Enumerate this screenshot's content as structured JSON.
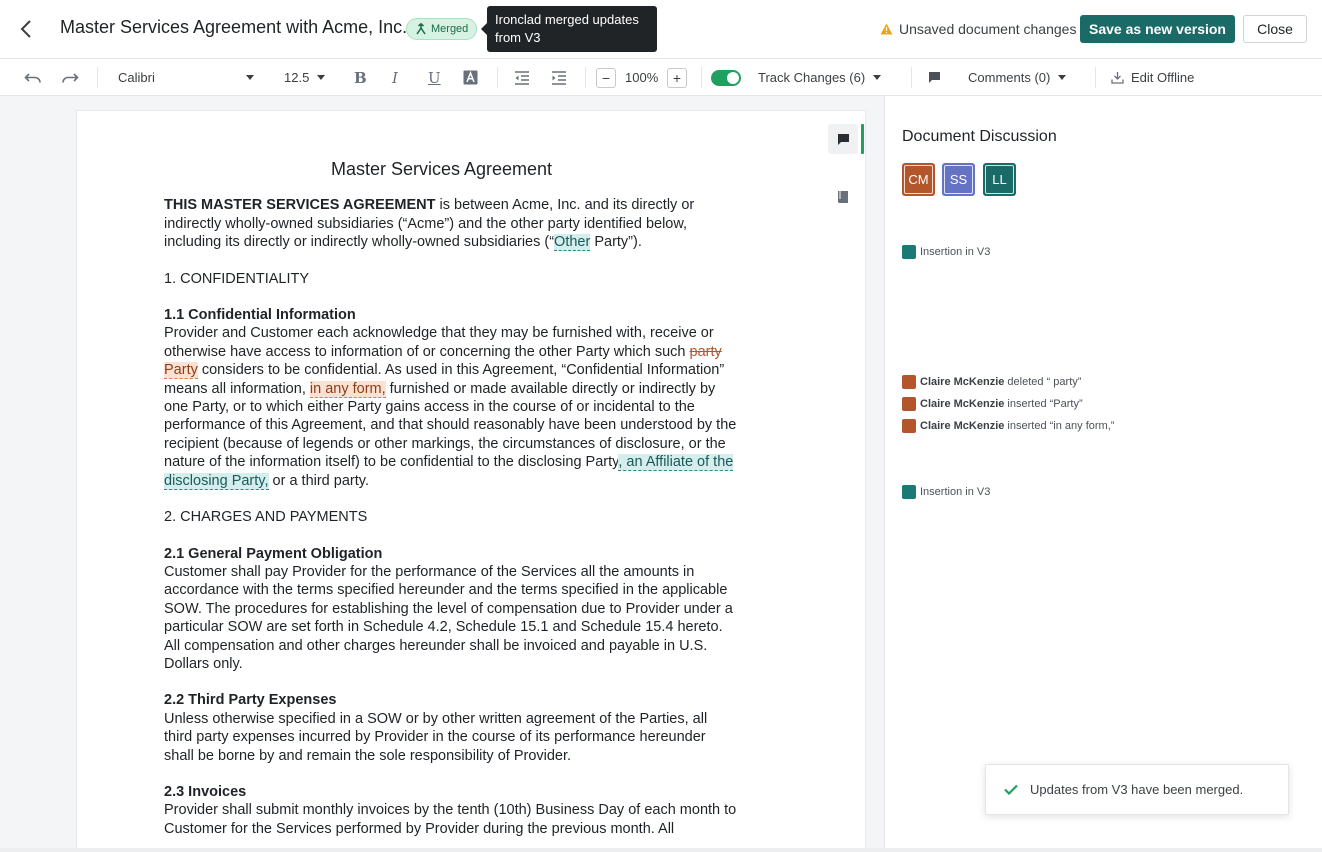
{
  "header": {
    "title": "Master Services Agreement with Acme, Inc.",
    "badge": "Merged",
    "tooltip": "Ironclad merged updates from V3",
    "unsaved": "Unsaved document changes",
    "save_label": "Save as new version",
    "close_label": "Close"
  },
  "toolbar": {
    "font": "Calibri",
    "size": "12.5",
    "zoom": "100%",
    "track_changes": "Track Changes (6)",
    "comments": "Comments (0)",
    "edit_offline": "Edit Offline",
    "track_changes_on": true
  },
  "document": {
    "heading": "Master Services Agreement",
    "intro_bold": "THIS MASTER SERVICES AGREEMENT",
    "intro_a": " is between Acme, Inc. and its directly or indirectly wholly-owned subsidiaries (“Acme”) and the other party identified below, including its directly or indirectly wholly-owned subsidiaries (“",
    "intro_ins": "Other",
    "intro_b": " Party”).",
    "s1": "1.  CONFIDENTIALITY",
    "s1_1_title": "1.1  Confidential Information",
    "s1_1_a": "Provider and Customer each acknowledge that they may be furnished with, receive or otherwise have access to information of or concerning the other Party which such ",
    "s1_1_del": "party",
    "s1_1_ins1": "Party",
    "s1_1_b": " considers to be confidential. As used in this Agreement, “Confidential Information” means all information, ",
    "s1_1_ins2": "in any form,",
    "s1_1_c": " furnished or made available directly or indirectly by one Party, or to which either Party gains access in the course of or incidental to the performance of this Agreement, and that should reasonably have been understood by the recipient (because of legends or other markings, the circumstances of disclosure, or the nature of the information itself) to be confidential to the disclosing Party",
    "s1_1_ins3": ", an Affiliate of the disclosing Party,",
    "s1_1_d": " or a third party.",
    "s2": "2.  CHARGES AND PAYMENTS",
    "s2_1_title": "2.1  General Payment Obligation",
    "s2_1_text": "Customer shall pay Provider for the performance of the Services all the amounts in accordance with the terms specified hereunder and the terms specified in the applicable SOW. The procedures for establishing the level of compensation due to Provider under a particular SOW are set forth in Schedule 4.2, Schedule 15.1 and Schedule 15.4 hereto. All compensation and other charges hereunder shall be invoiced and payable in U.S. Dollars only.",
    "s2_2_title": "2.2  Third Party Expenses",
    "s2_2_text": "Unless otherwise specified in a SOW or by other written agreement of the Parties, all third party expenses incurred by Provider in the course of its performance hereunder shall be borne by and remain the sole responsibility of Provider.",
    "s2_3_title": "2.3  Invoices",
    "s2_3_text": "Provider shall submit monthly invoices by the tenth (10th) Business Day of each month to Customer for the Services performed by Provider during the previous month. All"
  },
  "sidebar": {
    "title": "Document Discussion",
    "avatars": [
      {
        "initials": "CM",
        "color": "#b4562b"
      },
      {
        "initials": "SS",
        "color": "#6473c4"
      },
      {
        "initials": "LL",
        "color": "#1a6b67"
      }
    ],
    "changes": [
      {
        "author": "",
        "action": "Insertion in V3",
        "color": "#1a7a74"
      },
      {
        "author": "Claire McKenzie",
        "action": " deleted “ party”",
        "color": "#b4562b"
      },
      {
        "author": "Claire McKenzie",
        "action": " inserted “Party”",
        "color": "#b4562b"
      },
      {
        "author": "Claire McKenzie",
        "action": " inserted “in any form,”",
        "color": "#b4562b"
      },
      {
        "author": "",
        "action": "Insertion in V3",
        "color": "#1a7a74"
      }
    ]
  },
  "toast": {
    "message": "Updates from V3 have been merged."
  }
}
